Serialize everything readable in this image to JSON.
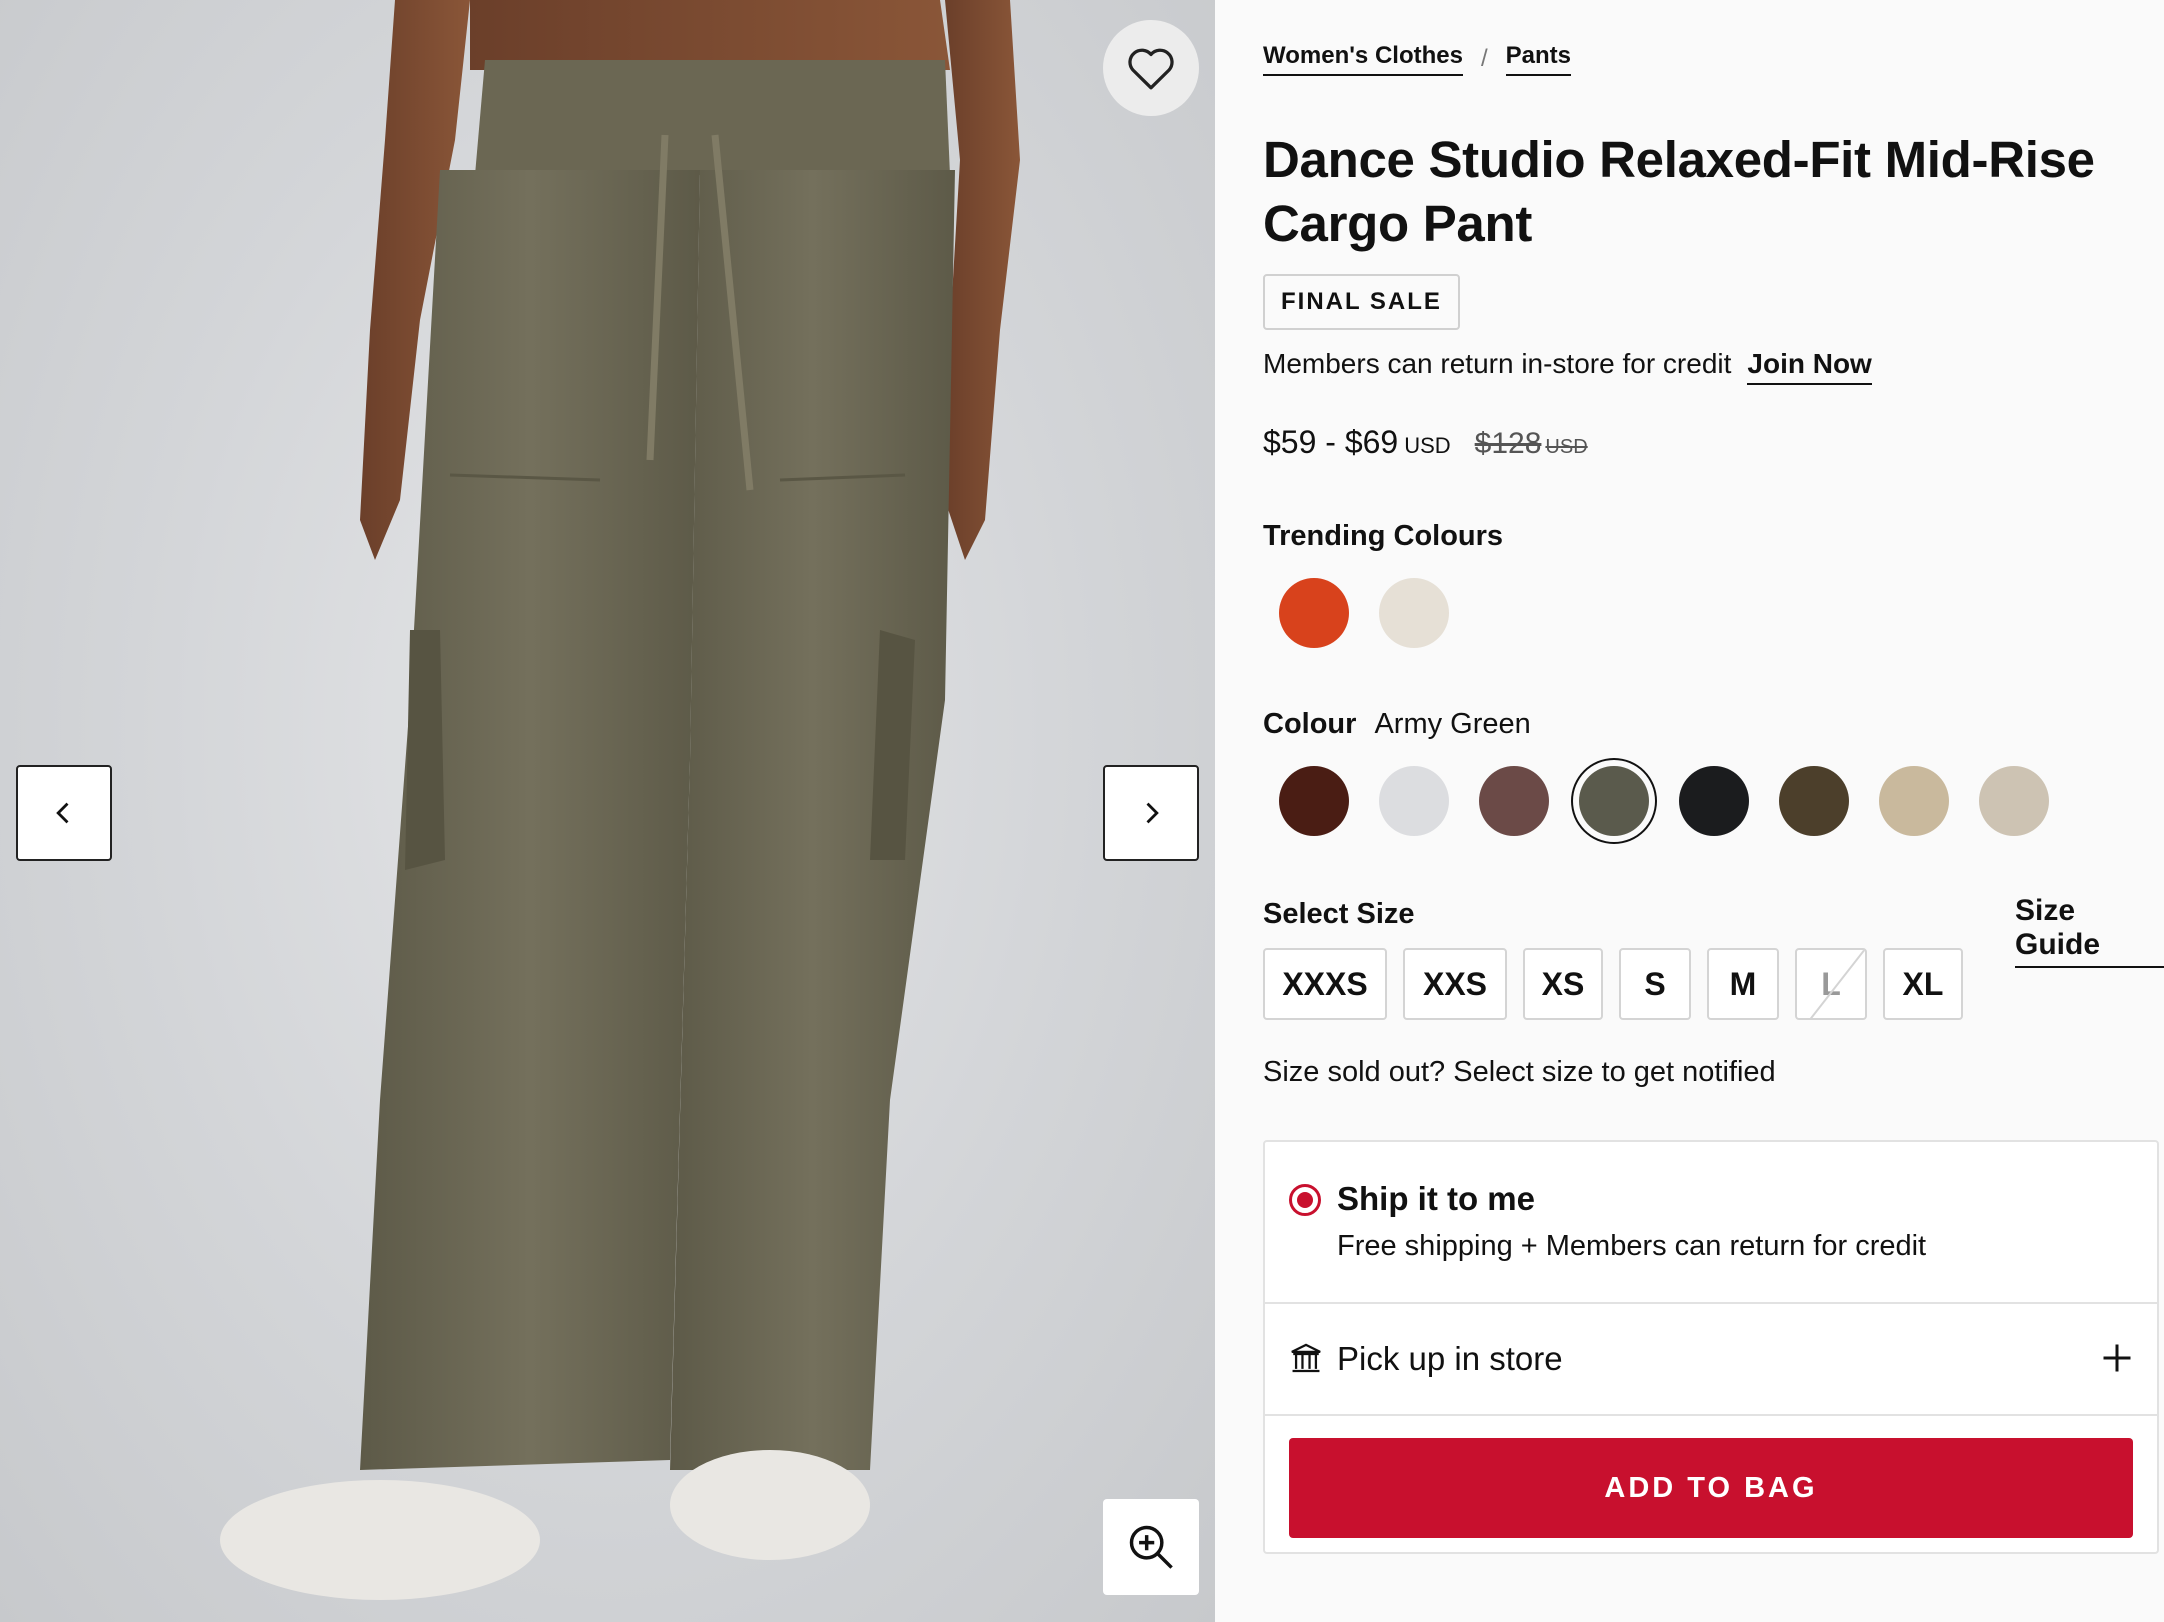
{
  "breadcrumb": {
    "items": [
      "Women's Clothes",
      "Pants"
    ],
    "separator": "/"
  },
  "product": {
    "title": "Dance Studio Relaxed-Fit Mid-Rise Cargo Pant",
    "badge": "FINAL SALE",
    "members_note": "Members can return in-store for credit",
    "join_now": "Join Now",
    "price": {
      "current": "$59 - $69",
      "currency": "USD",
      "original": "$128",
      "original_currency": "USD"
    }
  },
  "trending": {
    "label": "Trending Colours",
    "swatches": [
      {
        "name": "orange",
        "color": "#d8421c"
      },
      {
        "name": "cream",
        "color": "#e6e0d6"
      }
    ]
  },
  "colour": {
    "label": "Colour",
    "selected": "Army Green",
    "swatches": [
      {
        "name": "brown",
        "color": "#4a1d14"
      },
      {
        "name": "light-grey",
        "color": "#dcdde0"
      },
      {
        "name": "mauve-brown",
        "color": "#6b4a47"
      },
      {
        "name": "army-green",
        "color": "#5a5a4c",
        "selected": true
      },
      {
        "name": "black",
        "color": "#1b1c1e"
      },
      {
        "name": "dark-olive",
        "color": "#4c3f2b"
      },
      {
        "name": "tan",
        "color": "#c9b99d"
      },
      {
        "name": "oat",
        "color": "#cdc3b3"
      }
    ]
  },
  "size": {
    "label": "Select Size",
    "guide": "Size Guide",
    "options": [
      {
        "label": "XXXS",
        "sold_out": false
      },
      {
        "label": "XXS",
        "sold_out": false
      },
      {
        "label": "XS",
        "sold_out": false
      },
      {
        "label": "S",
        "sold_out": false
      },
      {
        "label": "M",
        "sold_out": false
      },
      {
        "label": "L",
        "sold_out": true
      },
      {
        "label": "XL",
        "sold_out": false
      }
    ],
    "note": "Size sold out? Select size to get notified"
  },
  "delivery": {
    "ship": {
      "title": "Ship it to me",
      "subtitle": "Free shipping + Members can return for credit",
      "selected": true
    },
    "pickup": {
      "label": "Pick up in store"
    },
    "add_button": "ADD TO BAG"
  },
  "theme": {
    "accent": "#c8102e",
    "pant_color": "#6e6a56"
  },
  "icons": {
    "favorite": "heart-icon",
    "previous": "chevron-left-icon",
    "next": "chevron-right-icon",
    "zoom": "zoom-in-icon",
    "store": "store-icon",
    "expand": "plus-icon"
  }
}
